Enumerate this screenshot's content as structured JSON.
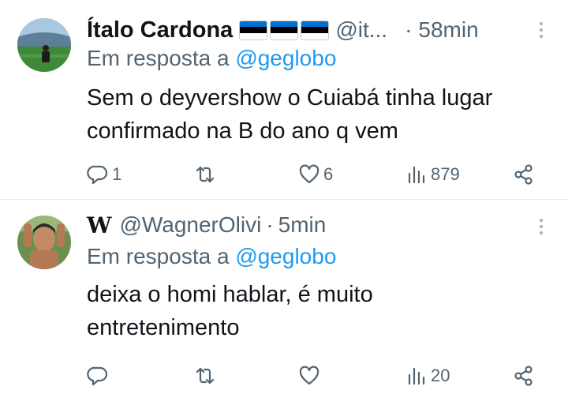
{
  "tweets": [
    {
      "name": "Ítalo Cardona",
      "handle": "@it...",
      "time": "58min",
      "reply_prefix": "Em resposta a ",
      "reply_to": "@geglobo",
      "lines": [
        "Sem o deyvershow o Cuiabá tinha lugar",
        "confirmado na B do ano q vem"
      ],
      "replies": "1",
      "retweets": "",
      "likes": "6",
      "views": "879",
      "flag_colors": [
        "#0072ce",
        "#000000",
        "#ffffff"
      ]
    },
    {
      "logo": "W",
      "handle": "@WagnerOlivi",
      "time": "5min",
      "reply_prefix": "Em resposta a ",
      "reply_to": "@geglobo",
      "lines": [
        "deixa o homi hablar, é muito",
        "entretenimento"
      ],
      "replies": "",
      "retweets": "",
      "likes": "",
      "views": "20"
    }
  ],
  "colors": {
    "accent": "#1d9bf0",
    "muted": "#536471",
    "text": "#0f1419"
  },
  "icons": [
    "reply-icon",
    "retweet-icon",
    "like-icon",
    "views-icon",
    "share-icon",
    "more-options-icon"
  ]
}
